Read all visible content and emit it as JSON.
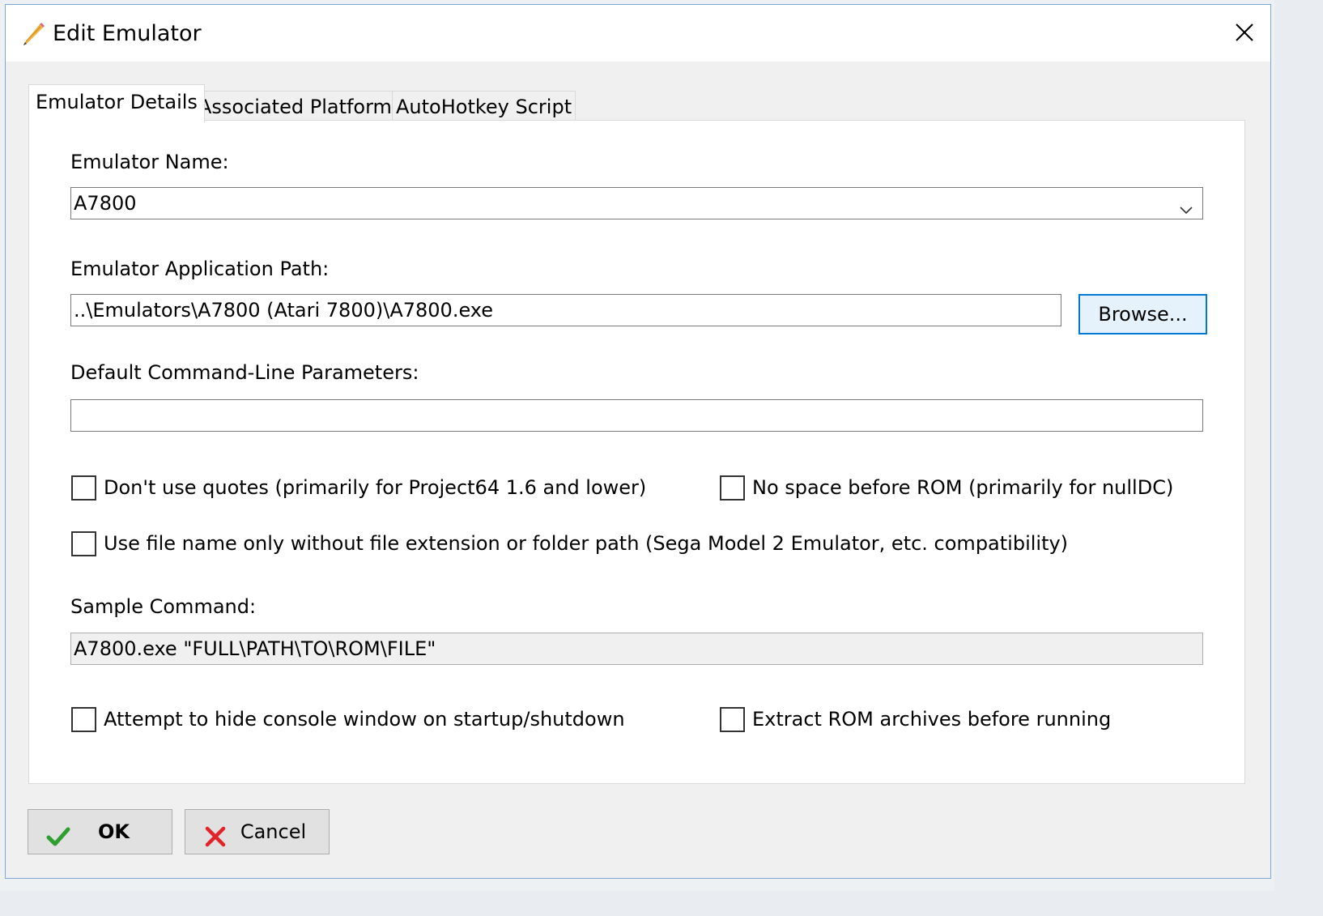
{
  "window": {
    "title": "Edit Emulator"
  },
  "tabs": [
    {
      "label": "Emulator Details",
      "active": true
    },
    {
      "label": "Associated Platforms",
      "active": false
    },
    {
      "label": "AutoHotkey Script",
      "active": false
    }
  ],
  "form": {
    "name_label": "Emulator Name:",
    "name_value": "A7800",
    "path_label": "Emulator Application Path:",
    "path_value": "..\\Emulators\\A7800 (Atari 7800)\\A7800.exe",
    "browse_label": "Browse...",
    "params_label": "Default Command-Line Parameters:",
    "params_value": "",
    "checkboxes": {
      "no_quotes": {
        "label": "Don't use quotes (primarily for Project64 1.6 and lower)",
        "checked": false
      },
      "no_space": {
        "label": "No space before ROM (primarily for nullDC)",
        "checked": false
      },
      "file_name_only": {
        "label": "Use file name only without file extension or folder path (Sega Model 2 Emulator, etc. compatibility)",
        "checked": false
      },
      "hide_console": {
        "label": "Attempt to hide console window on startup/shutdown",
        "checked": false
      },
      "extract_rom": {
        "label": "Extract ROM archives before running",
        "checked": false
      }
    },
    "sample_label": "Sample Command:",
    "sample_value": "A7800.exe \"FULL\\PATH\\TO\\ROM\\FILE\""
  },
  "footer": {
    "ok_label": "OK",
    "cancel_label": "Cancel"
  },
  "icons": {
    "title": "pencil-icon",
    "ok": "checkmark-icon",
    "cancel": "red-x-icon",
    "close": "close-icon",
    "dropdown": "chevron-down-icon"
  },
  "colors": {
    "focus_border": "#0078d7",
    "ok_green": "#2e9e2e",
    "cancel_red": "#e0242a"
  }
}
